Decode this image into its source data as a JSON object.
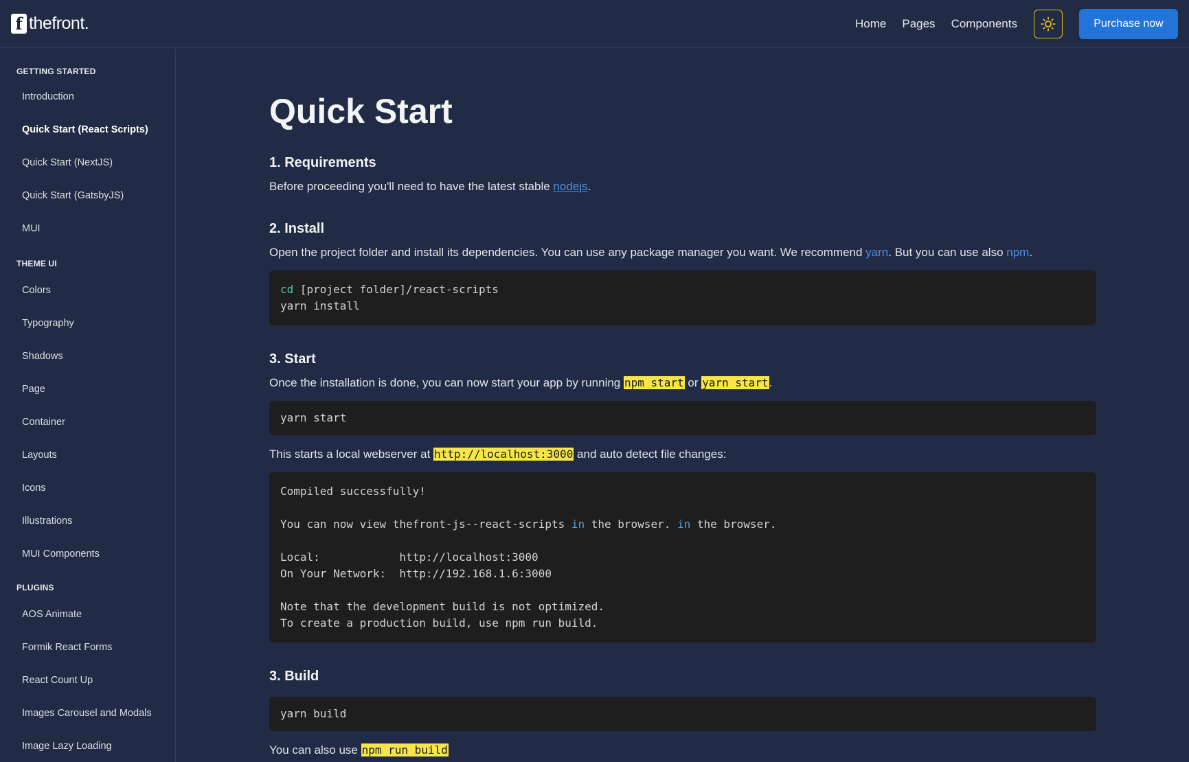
{
  "header": {
    "logo_mark": "f",
    "logo_text": "thefront.",
    "nav": [
      "Home",
      "Pages",
      "Components"
    ],
    "theme_toggle_icon": "sun-icon",
    "purchase_label": "Purchase now",
    "accent": "#2374d8"
  },
  "sidebar": {
    "sections": [
      {
        "title": "GETTING STARTED",
        "items": [
          "Introduction",
          "Quick Start (React Scripts)",
          "Quick Start (NextJS)",
          "Quick Start (GatsbyJS)",
          "MUI"
        ]
      },
      {
        "title": "THEME UI",
        "items": [
          "Colors",
          "Typography",
          "Shadows",
          "Page",
          "Container",
          "Layouts",
          "Icons",
          "Illustrations",
          "MUI Components"
        ]
      },
      {
        "title": "PLUGINS",
        "items": [
          "AOS Animate",
          "Formik React Forms",
          "React Count Up",
          "Images Carousel and Modals",
          "Image Lazy Loading"
        ]
      }
    ],
    "active_item": "Quick Start (React Scripts)"
  },
  "main": {
    "title": "Quick Start",
    "s1": {
      "heading": "1. Requirements",
      "text_before": "Before proceeding you'll need to have the latest stable ",
      "link": "nodejs",
      "text_after": "."
    },
    "s2": {
      "heading": "2. Install",
      "text_before": "Open the project folder and install its dependencies. You can use any package manager you want. We recommend ",
      "link1": "yarn",
      "text_mid": ". But you can use also ",
      "link2": "npm",
      "text_after": ".",
      "code_cmd": "cd",
      "code_line1_rest": " [project folder]/react-scripts",
      "code_line2": "yarn install"
    },
    "s3": {
      "heading": "3. Start",
      "text_before": "Once the installation is done, you can now start your app by running ",
      "hl1": "npm start",
      "text_mid": " or ",
      "hl2": "yarn start",
      "text_after": ".",
      "code": "yarn start",
      "p2_before": "This starts a local webserver at ",
      "p2_hl": "http://localhost:3000",
      "p2_after": " and auto detect file changes:",
      "out_line1": "Compiled successfully!",
      "out_line2a": "You can now view thefront-js--react-scripts ",
      "out_in": "in",
      "out_line2b": " the browser. ",
      "out_line2c": " the browser.",
      "out_line3": "Local:            http://localhost:3000",
      "out_line4": "On Your Network:  http://192.168.1.6:3000",
      "out_line5": "Note that the development build is not optimized.",
      "out_line6": "To create a production build, use npm run build."
    },
    "s4": {
      "heading": "3. Build",
      "code": "yarn build",
      "trailing_text": "You can also use ",
      "trailing_hl": "npm run build"
    }
  }
}
